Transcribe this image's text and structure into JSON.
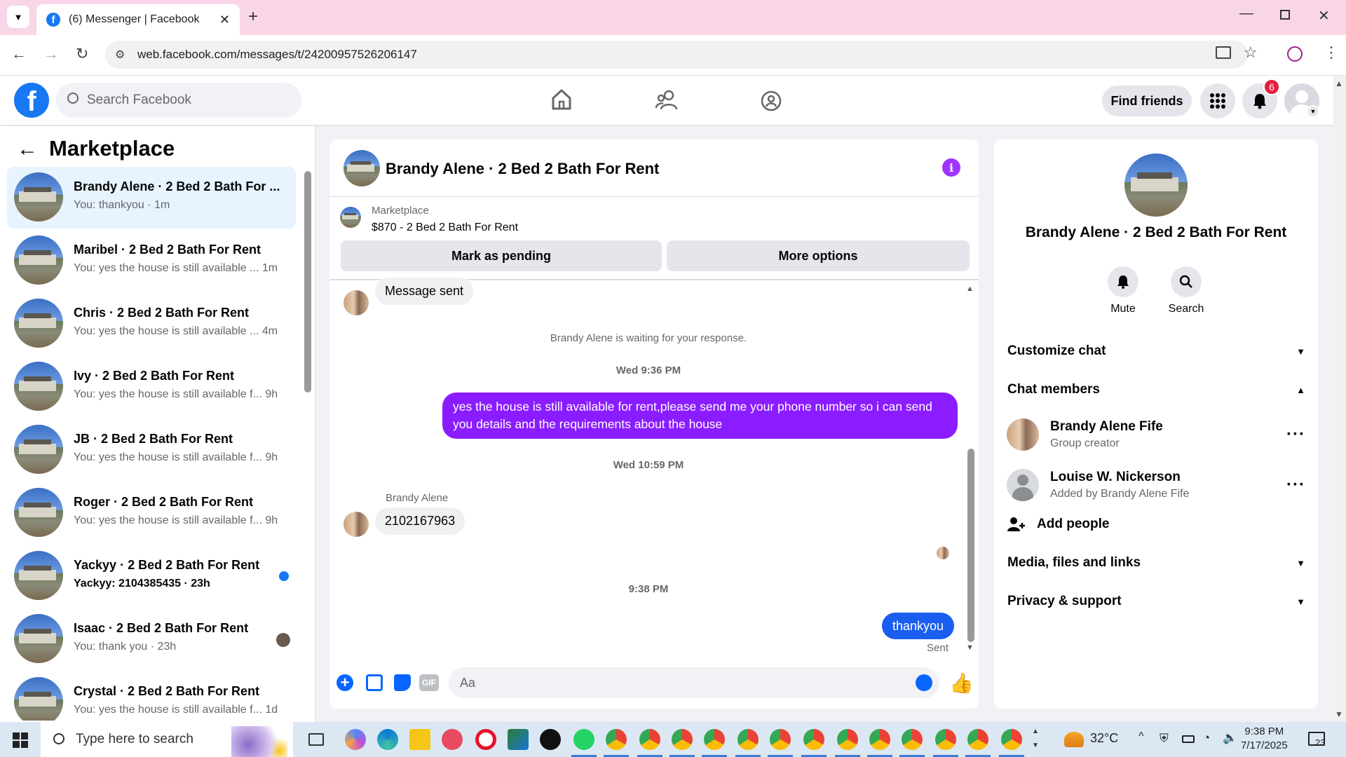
{
  "browser": {
    "tab_title": "(6) Messenger | Facebook",
    "url": "web.facebook.com/messages/t/24200957526206147"
  },
  "header": {
    "search_placeholder": "Search Facebook",
    "find_friends": "Find friends",
    "notification_count": "6"
  },
  "sidebar": {
    "title": "Marketplace",
    "conversations": [
      {
        "name": "Brandy Alene · 2 Bed 2 Bath For ...",
        "snippet": "You: thankyou · 1m",
        "active": true
      },
      {
        "name": "Maribel · 2 Bed 2 Bath For Rent",
        "snippet": "You: yes the house is still available ...  1m"
      },
      {
        "name": "Chris · 2 Bed 2 Bath For Rent",
        "snippet": "You: yes the house is still available ...  4m"
      },
      {
        "name": "Ivy · 2 Bed 2 Bath For Rent",
        "snippet": "You: yes the house is still available f... 9h"
      },
      {
        "name": "JB · 2 Bed 2 Bath For Rent",
        "snippet": "You: yes the house is still available f... 9h"
      },
      {
        "name": "Roger · 2 Bed 2 Bath For Rent",
        "snippet": "You: yes the house is still available f... 9h"
      },
      {
        "name": "Yackyy · 2 Bed 2 Bath For Rent",
        "snippet": "Yackyy: 2104385435 · 23h",
        "unread": true
      },
      {
        "name": "Isaac · 2 Bed 2 Bath For Rent",
        "snippet": "You: thank you · 23h"
      },
      {
        "name": "Crystal · 2 Bed 2 Bath For Rent",
        "snippet": "You: yes the house is still available f... 1d"
      }
    ]
  },
  "chat": {
    "title": "Brandy Alene · 2 Bed 2 Bath For Rent",
    "marketplace_label": "Marketplace",
    "listing": "$870 - 2 Bed 2 Bath For Rent",
    "mark_pending": "Mark as pending",
    "more_options": "More options",
    "messages": {
      "message_sent": "Message sent",
      "waiting": "Brandy Alene is waiting for your response.",
      "time1": "Wed 9:36 PM",
      "outgoing1": "yes the house is still available for rent,please send me your phone number so i can send you details and the requirements about the house",
      "time2": "Wed 10:59 PM",
      "sender_name": "Brandy Alene",
      "incoming1": "2102167963",
      "time3": "9:38 PM",
      "outgoing2": "thankyou",
      "status": "Sent"
    },
    "composer_placeholder": "Aa",
    "gif_label": "GIF"
  },
  "right_panel": {
    "name": "Brandy Alene · 2 Bed 2 Bath For Rent",
    "mute": "Mute",
    "search": "Search",
    "customize_chat": "Customize chat",
    "chat_members": "Chat members",
    "members": [
      {
        "name": "Brandy Alene Fife",
        "role": "Group creator"
      },
      {
        "name": "Louise W. Nickerson",
        "role": "Added by Brandy Alene Fife"
      }
    ],
    "add_people": "Add people",
    "media": "Media, files and links",
    "privacy": "Privacy & support"
  },
  "taskbar": {
    "search_placeholder": "Type here to search",
    "temperature": "32°C",
    "time": "9:38 PM",
    "date": "7/17/2025",
    "notification_count": "23"
  },
  "colors": {
    "brand_blue": "#1877f2",
    "outgoing_bubble": "#8a1cff",
    "active_convo": "#e7f3ff"
  }
}
